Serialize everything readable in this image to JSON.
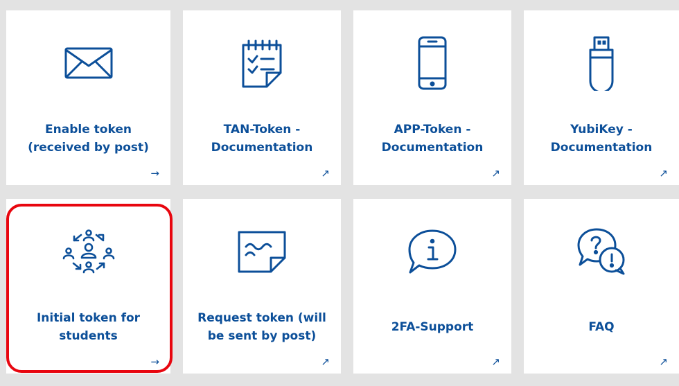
{
  "colors": {
    "background": "#e3e3e3",
    "tile": "#ffffff",
    "accent": "#0c4f99",
    "highlight": "#e8060f"
  },
  "tiles": [
    {
      "label": "Enable token\n(received by post)",
      "icon": "envelope-icon",
      "arrow": "→",
      "arrow_icon": "arrow-right-icon"
    },
    {
      "label": "TAN-Token -\nDocumentation",
      "icon": "tan-list-icon",
      "arrow": "↗",
      "arrow_icon": "external-link-arrow-icon"
    },
    {
      "label": "APP-Token -\nDocumentation",
      "icon": "smartphone-icon",
      "arrow": "↗",
      "arrow_icon": "external-link-arrow-icon"
    },
    {
      "label": "YubiKey -\nDocumentation",
      "icon": "usb-key-icon",
      "arrow": "↗",
      "arrow_icon": "external-link-arrow-icon"
    },
    {
      "label": "Initial token for\nstudents",
      "icon": "people-network-icon",
      "arrow": "→",
      "arrow_icon": "arrow-right-icon"
    },
    {
      "label": "Request token (will\nbe sent by post)",
      "icon": "letter-note-icon",
      "arrow": "↗",
      "arrow_icon": "external-link-arrow-icon"
    },
    {
      "label": "2FA-Support",
      "icon": "info-speech-bubble-icon",
      "arrow": "↗",
      "arrow_icon": "external-link-arrow-icon"
    },
    {
      "label": "FAQ",
      "icon": "faq-speech-bubbles-icon",
      "arrow": "↗",
      "arrow_icon": "external-link-arrow-icon"
    }
  ]
}
